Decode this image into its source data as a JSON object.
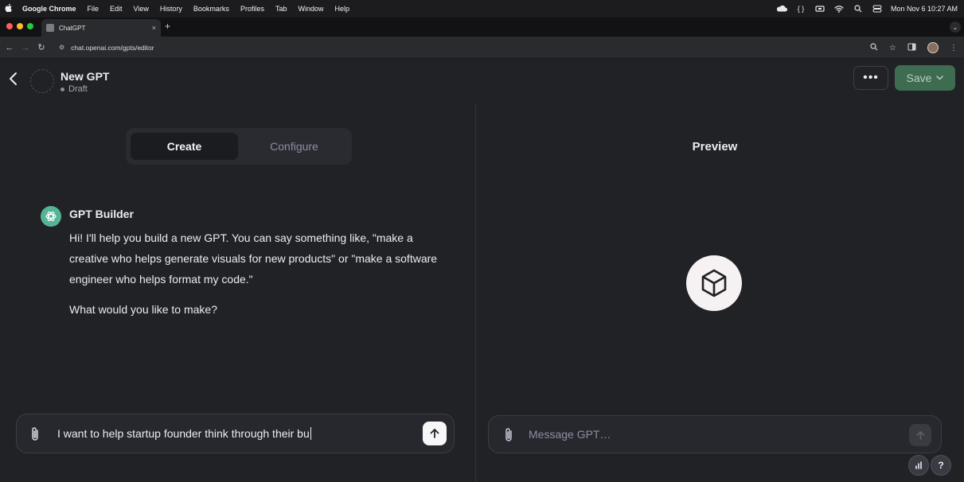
{
  "menubar": {
    "app_name": "Google Chrome",
    "items": [
      "File",
      "Edit",
      "View",
      "History",
      "Bookmarks",
      "Profiles",
      "Tab",
      "Window",
      "Help"
    ],
    "clock": "Mon Nov 6  10:27 AM"
  },
  "browser": {
    "tab_title": "ChatGPT",
    "tab_close": "×",
    "new_tab": "+",
    "url": "chat.openai.com/gpts/editor"
  },
  "header": {
    "gpt_name": "New GPT",
    "gpt_status": "Draft",
    "more_label": "•••",
    "save_label": "Save"
  },
  "editor": {
    "tabs": [
      {
        "label": "Create",
        "active": true
      },
      {
        "label": "Configure",
        "active": false
      }
    ],
    "message": {
      "author": "GPT Builder",
      "text": "Hi! I'll help you build a new GPT. You can say something like, \"make a creative who helps generate visuals for new products\" or \"make a software engineer who helps format my code.\"",
      "question": "What would you like to make?"
    },
    "composer_value": "I want to help startup founder think through their bu"
  },
  "preview": {
    "title": "Preview",
    "placeholder": "Message GPT…",
    "help_label": "?"
  },
  "colors": {
    "background": "#212226",
    "save_button": "#3e6c50",
    "builder_avatar": "#55b495"
  }
}
